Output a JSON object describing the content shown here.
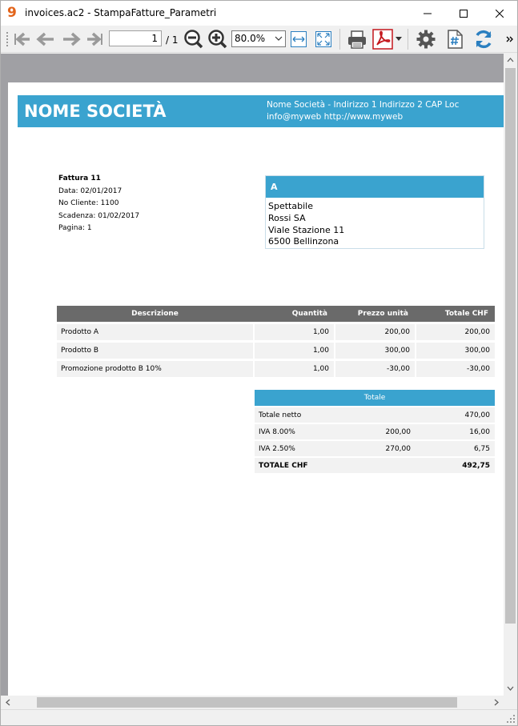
{
  "window": {
    "title": "invoices.ac2 - StampaFatture_Parametri",
    "app_icon": "9"
  },
  "toolbar": {
    "page_current": "1",
    "page_total": "/ 1",
    "zoom": "80.0%"
  },
  "invoice": {
    "company_name": "NOME SOCIETÀ",
    "company_info_line1": "Nome Società - Indirizzo 1 Indirizzo 2 CAP Loc",
    "company_info_line2": "info@myweb http://www.myweb",
    "number": "Fattura 11",
    "date": "Data: 02/01/2017",
    "customer_no": "No Cliente: 1100",
    "due": "Scadenza: 01/02/2017",
    "page": "Pagina: 1",
    "address_header": "A",
    "address": {
      "line1": "Spettabile",
      "line2": "Rossi SA",
      "line3": "Viale Stazione 11",
      "line4": "6500 Bellinzona"
    },
    "columns": {
      "description": "Descrizione",
      "quantity": "Quantità",
      "unit_price": "Prezzo unità",
      "total": "Totale CHF"
    },
    "items": [
      {
        "description": "Prodotto A",
        "quantity": "1,00",
        "unit_price": "200,00",
        "total": "200,00"
      },
      {
        "description": "Prodotto B",
        "quantity": "1,00",
        "unit_price": "300,00",
        "total": "300,00"
      },
      {
        "description": "Promozione prodotto B 10%",
        "quantity": "1,00",
        "unit_price": "-30,00",
        "total": "-30,00"
      }
    ],
    "totals": {
      "header": "Totale",
      "net_label": "Totale netto",
      "net": "470,00",
      "vat1_label": "IVA 8.00%",
      "vat1_base": "200,00",
      "vat1": "16,00",
      "vat2_label": "IVA 2.50%",
      "vat2_base": "270,00",
      "vat2": "6,75",
      "total_label": "TOTALE CHF",
      "total": "492,75"
    }
  },
  "colors": {
    "accent": "#3aa3cf",
    "table_header": "#6a6a6a",
    "row_bg": "#f2f2f2",
    "viewport_bg": "#a0a0a4"
  }
}
